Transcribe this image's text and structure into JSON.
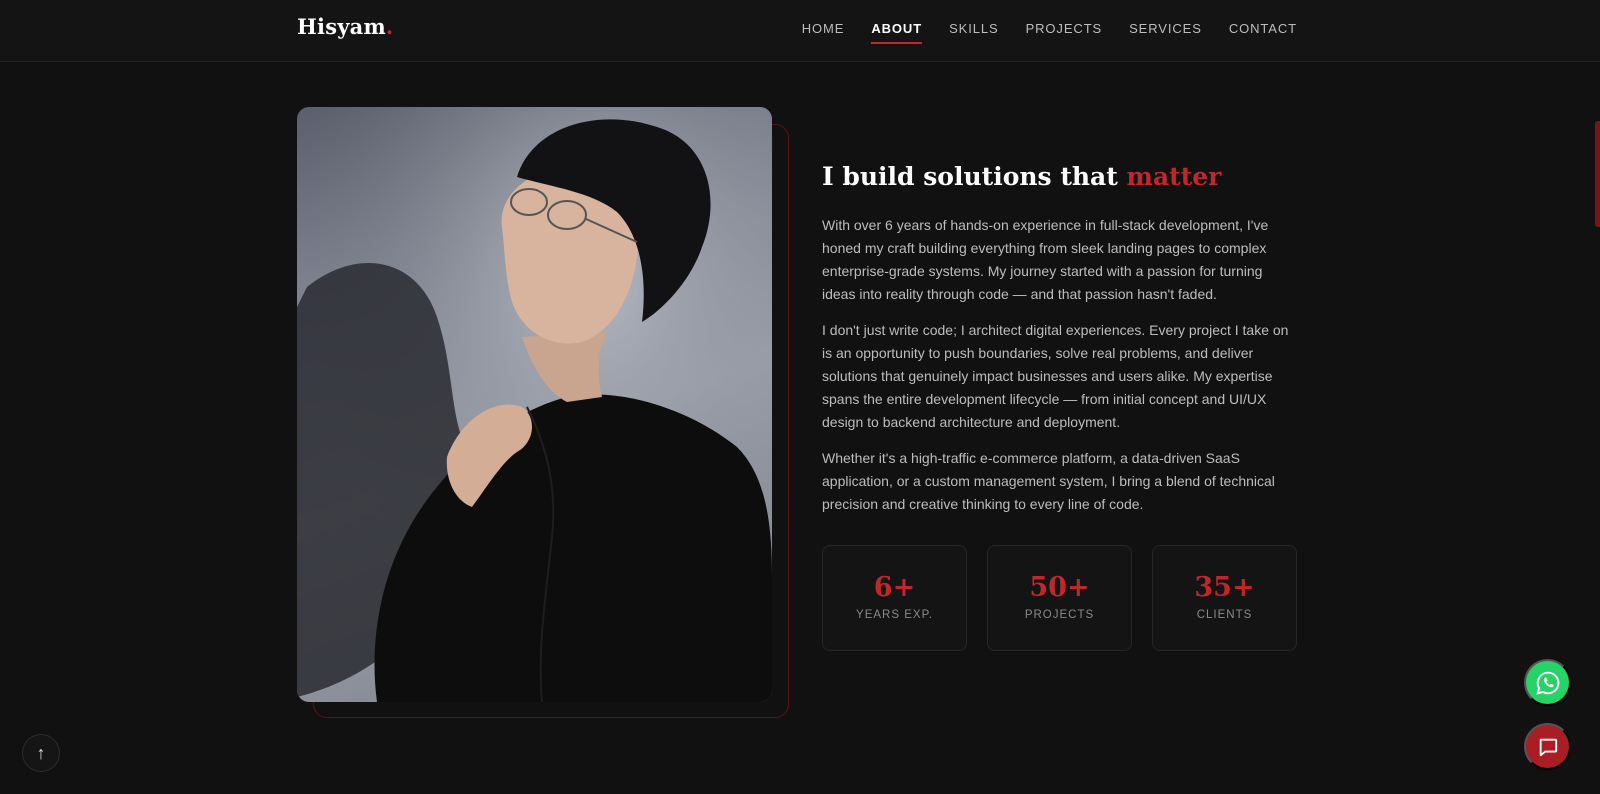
{
  "header": {
    "logo": "Hisyam",
    "logo_dot": ".",
    "nav": [
      "HOME",
      "ABOUT",
      "SKILLS",
      "PROJECTS",
      "SERVICES",
      "CONTACT"
    ],
    "active_nav": "ABOUT"
  },
  "about": {
    "title": "I build solutions that",
    "title_accent": "matter",
    "paragraphs": [
      "With over 6 years of hands-on experience in full-stack development, I've honed my craft building everything from sleek landing pages to complex enterprise-grade systems. My journey started with a passion for turning ideas into reality through code — and that passion hasn't faded.",
      "I don't just write code; I architect digital experiences. Every project I take on is an opportunity to push boundaries, solve real problems, and deliver solutions that genuinely impact businesses and users alike. My expertise spans the entire development lifecycle — from initial concept and UI/UX design to backend architecture and deployment.",
      "Whether it's a high-traffic e-commerce platform, a data-driven SaaS application, or a custom management system, I bring a blend of technical precision and creative thinking to every line of code."
    ],
    "stats": [
      {
        "value": "6+",
        "label": "YEARS EXP."
      },
      {
        "value": "50+",
        "label": "PROJECTS"
      },
      {
        "value": "35+",
        "label": "CLIENTS"
      }
    ]
  },
  "controls": {
    "scroll_top_icon": "arrow-up-icon",
    "scroll_top_glyph": "↑",
    "whatsapp_icon": "whatsapp-icon",
    "chat_icon": "chat-icon"
  },
  "colors": {
    "accent": "#c0272d",
    "background": "#111111",
    "whatsapp": "#25d366"
  }
}
